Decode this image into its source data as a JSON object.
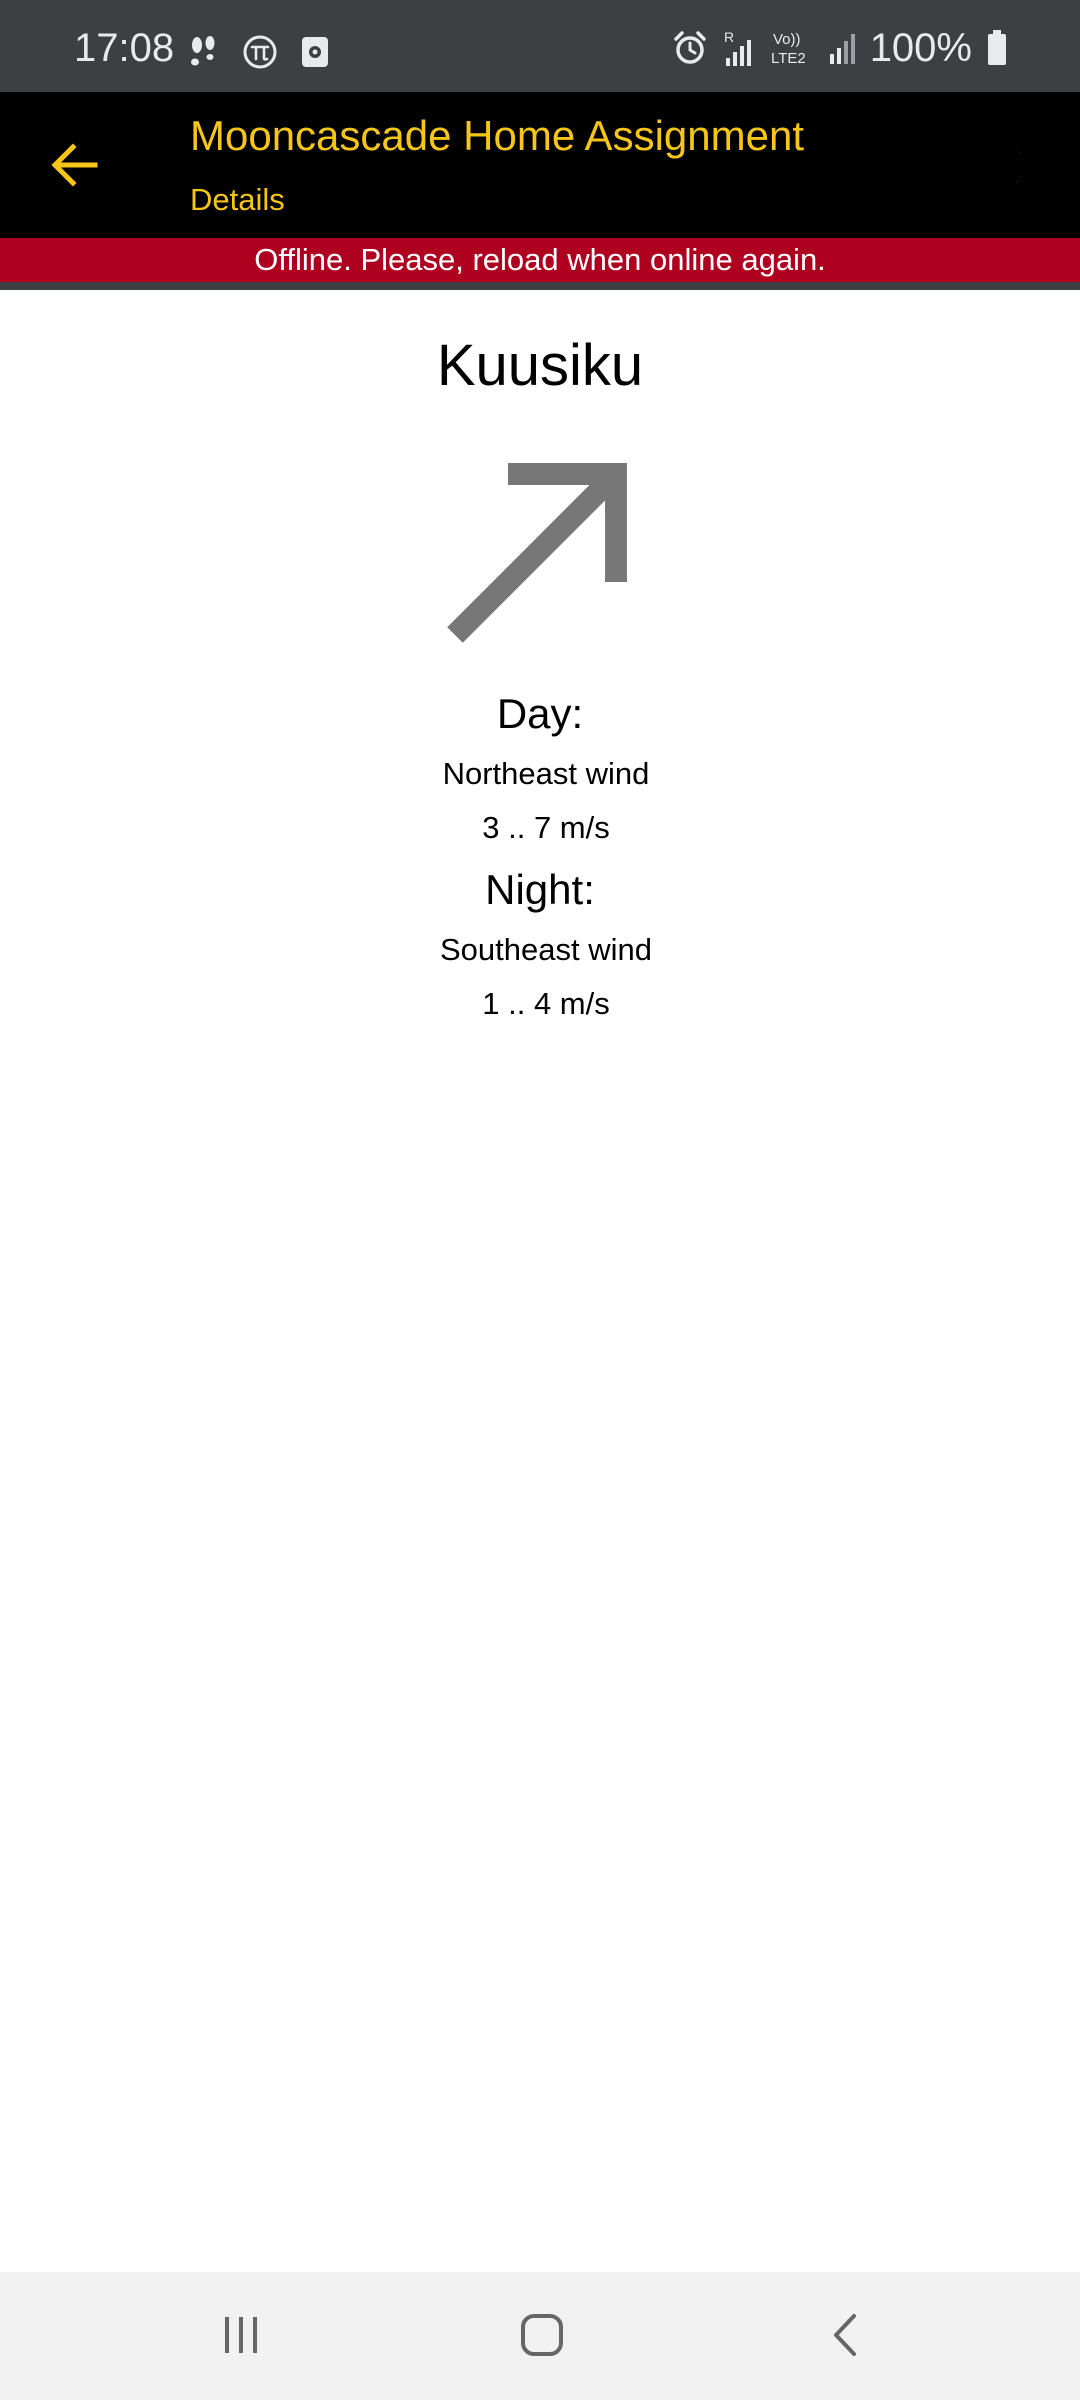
{
  "status_bar": {
    "time": "17:08",
    "battery_text": "100%",
    "left_icons": [
      "steps-icon",
      "pi-icon",
      "screen-record-icon"
    ],
    "right_icons": [
      "alarm-icon",
      "roaming-signal-icon",
      "volte-lte2-icon",
      "signal-icon",
      "battery-icon"
    ],
    "volte_line1": "Vo))",
    "volte_line2": "LTE2",
    "roaming_label": "R"
  },
  "app_bar": {
    "title": "Mooncascade Home Assignment",
    "subtitle": "Details",
    "accent_color": "#f5c518",
    "back_icon": "arrow-left-icon",
    "theme_icon": "crescent-moon-icon"
  },
  "banner": {
    "text": "Offline. Please, reload when online again.",
    "color": "#b00020"
  },
  "details": {
    "place_name": "Kuusiku",
    "arrow_icon": "arrow-northeast-icon",
    "day": {
      "label": "Day:",
      "direction": "Northeast wind",
      "speed": "3 .. 7 m/s"
    },
    "night": {
      "label": "Night:",
      "direction": "Southeast wind",
      "speed": "1 .. 4 m/s"
    }
  },
  "nav_bar": {
    "buttons": [
      "recent-apps-icon",
      "home-icon",
      "back-icon"
    ]
  }
}
